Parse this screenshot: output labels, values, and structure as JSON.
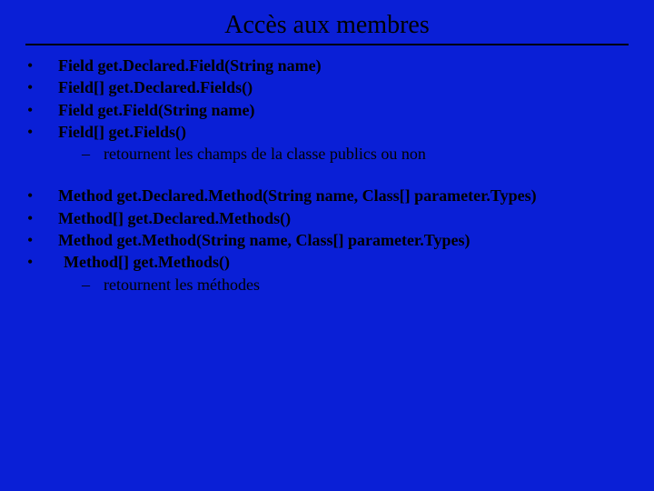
{
  "title": "Accès aux membres",
  "group1": {
    "items": [
      "Field get.Declared.Field(String name)",
      "Field[] get.Declared.Fields()",
      "Field get.Field(String name)",
      "Field[] get.Fields()"
    ],
    "sub": "retournent les champs de la classe publics ou non"
  },
  "group2": {
    "items": [
      "Method get.Declared.Method(String name, Class[] parameter.Types)",
      "Method[] get.Declared.Methods()",
      "Method get.Method(String name, Class[] parameter.Types)",
      " Method[] get.Methods()"
    ],
    "sub": "retournent les méthodes"
  },
  "glyphs": {
    "bullet": "•",
    "dash": "–"
  }
}
